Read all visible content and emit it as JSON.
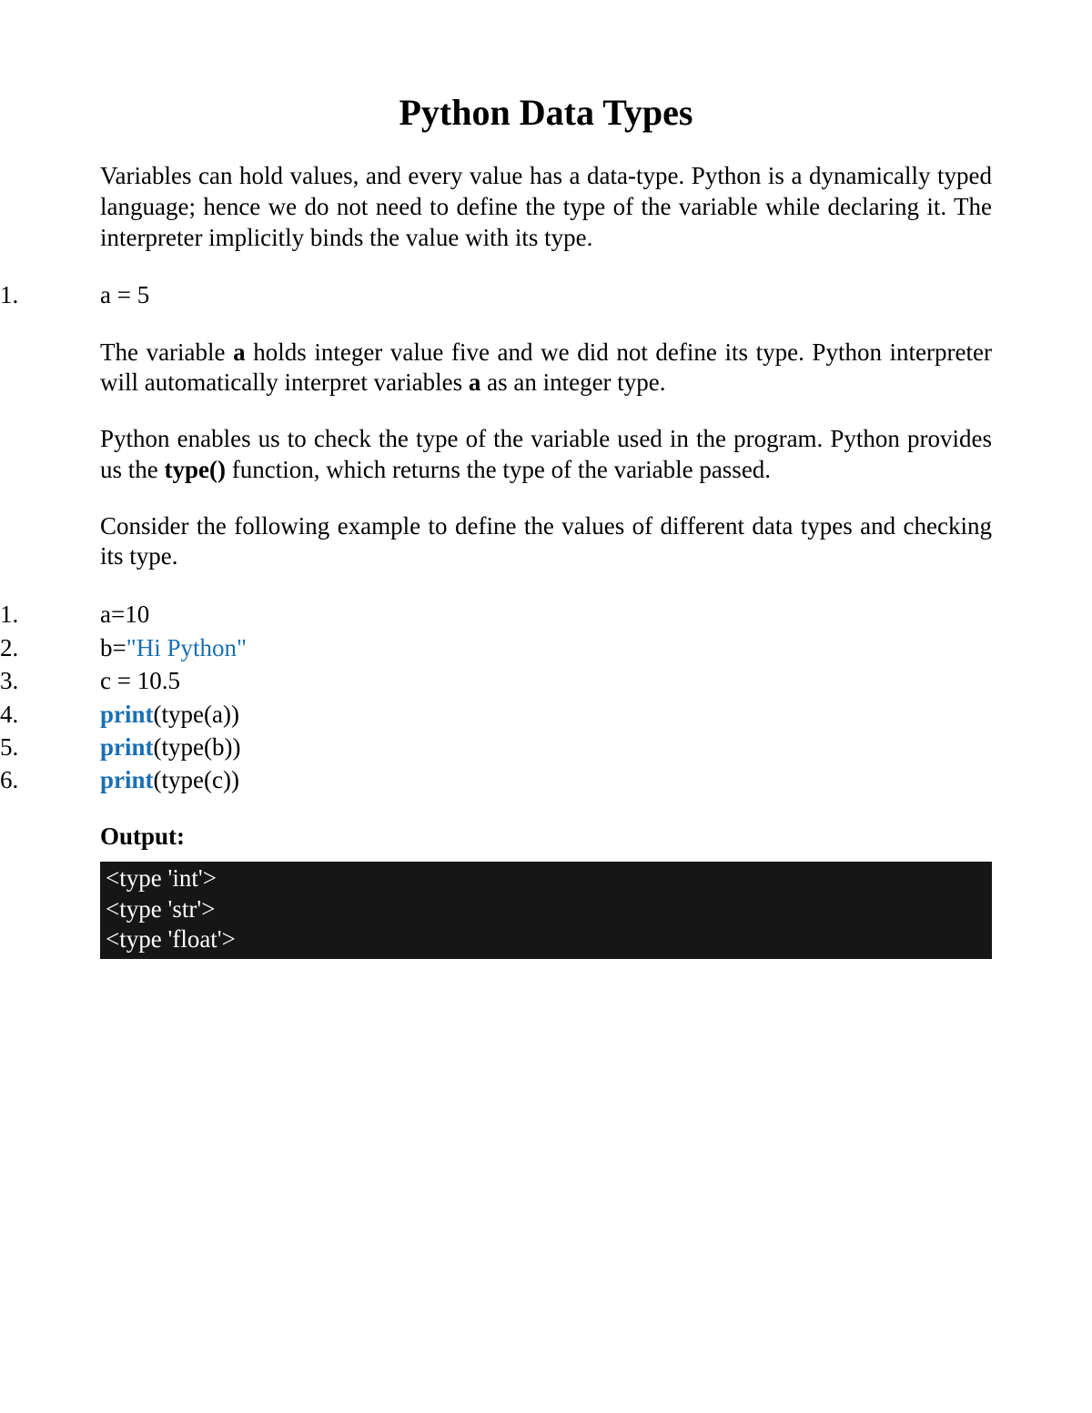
{
  "title": "Python Data Types",
  "para1": "Variables can hold values, and every value has a data-type. Python is a dynamically typed language; hence we do not need to define the type of the variable while declaring it. The interpreter implicitly binds the value with its type.",
  "example1": {
    "num": "1.",
    "code": "a = 5"
  },
  "para2_parts": {
    "prefix": "The variable ",
    "b1": "a",
    "mid1": " holds integer value five and we did not define its type. Python interpreter will automatically interpret variables ",
    "b2": "a",
    "suffix": " as an integer type."
  },
  "para3_parts": {
    "prefix": "Python enables us to check the type of the variable used in the program. Python provides us the ",
    "b1": "type()",
    "suffix": " function, which returns the type of the variable passed."
  },
  "para4": "Consider the following example to define the values of different data types and checking its type.",
  "code_lines": [
    {
      "num": "1.",
      "segs": [
        {
          "t": "a=10",
          "c": ""
        }
      ]
    },
    {
      "num": "2.",
      "segs": [
        {
          "t": "b=",
          "c": ""
        },
        {
          "t": "\"Hi Python\"",
          "c": "str"
        }
      ]
    },
    {
      "num": "3.",
      "segs": [
        {
          "t": "c = 10.5",
          "c": ""
        }
      ]
    },
    {
      "num": "4.",
      "segs": [
        {
          "t": "print",
          "c": "kw"
        },
        {
          "t": "(type(a))",
          "c": ""
        }
      ]
    },
    {
      "num": "5.",
      "segs": [
        {
          "t": "print",
          "c": "kw"
        },
        {
          "t": "(type(b))",
          "c": ""
        }
      ]
    },
    {
      "num": "6.",
      "segs": [
        {
          "t": "print",
          "c": "kw"
        },
        {
          "t": "(type(c))",
          "c": ""
        }
      ]
    }
  ],
  "output_label": "Output:",
  "output_lines": [
    "<type 'int'>",
    "<type 'str'>",
    "<type 'float'>"
  ]
}
